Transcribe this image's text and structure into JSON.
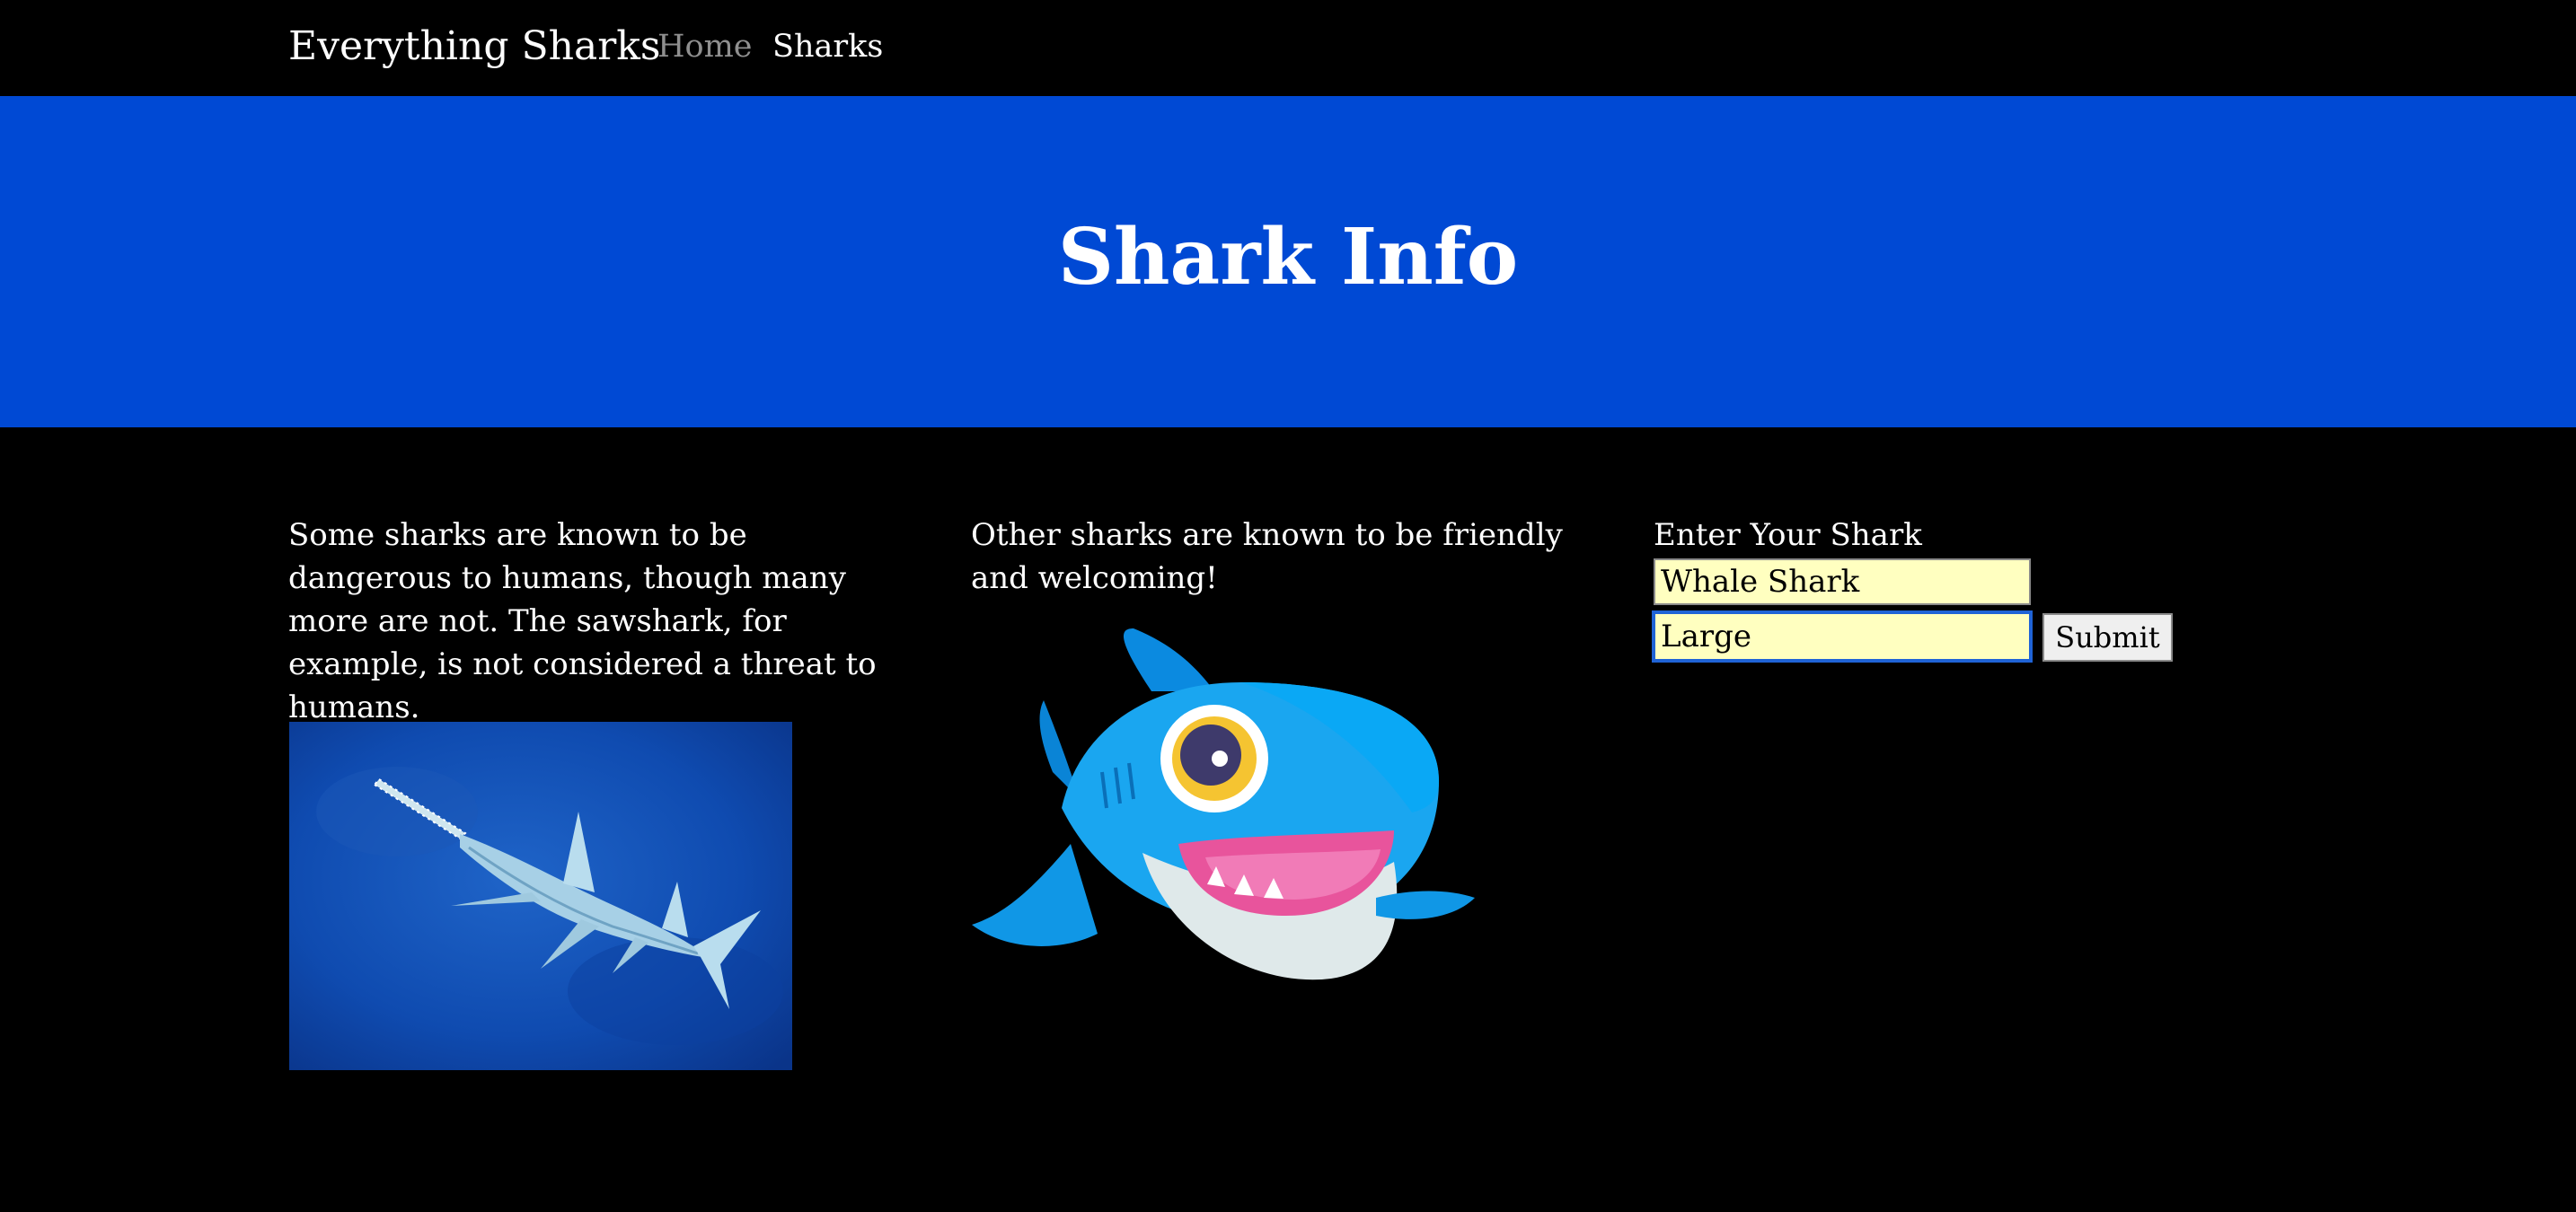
{
  "navbar": {
    "brand": "Everything Sharks",
    "links": [
      {
        "label": "Home"
      },
      {
        "label": "Sharks"
      }
    ]
  },
  "hero": {
    "title": "Shark Info"
  },
  "columns": {
    "left_text": "Some sharks are known to be dangerous to humans, though many more are not. The sawshark, for example, is not considered a threat to humans.",
    "middle_text": "Other sharks are known to be friendly and welcoming!"
  },
  "form": {
    "label": "Enter Your Shark",
    "field1_value": "Whale Shark",
    "field2_value": "Large",
    "submit_label": "Submit"
  },
  "colors": {
    "hero_bg": "#0049d4",
    "nav_inactive": "#8f8f8f",
    "input_bg": "#ffffc0"
  }
}
